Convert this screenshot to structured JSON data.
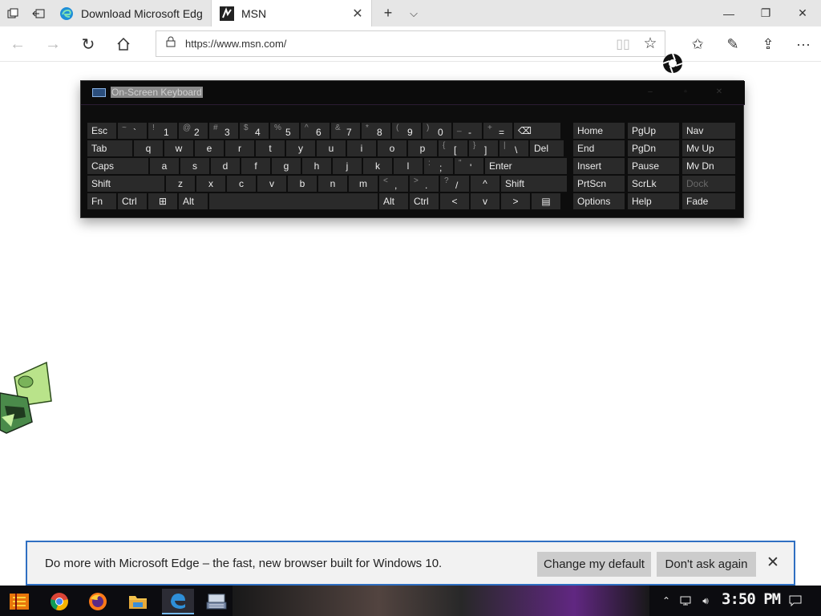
{
  "tabs": [
    {
      "title": "Download Microsoft Edge",
      "active": false
    },
    {
      "title": "MSN",
      "active": true
    }
  ],
  "address": {
    "url": "https://www.msn.com/"
  },
  "osk": {
    "title": "On-Screen Keyboard",
    "rows": [
      [
        {
          "label": "Esc",
          "w": 36
        },
        {
          "shift": "~",
          "main": "`",
          "w": 36
        },
        {
          "shift": "!",
          "main": "1",
          "w": 36
        },
        {
          "shift": "@",
          "main": "2",
          "w": 36
        },
        {
          "shift": "#",
          "main": "3",
          "w": 36
        },
        {
          "shift": "$",
          "main": "4",
          "w": 36
        },
        {
          "shift": "%",
          "main": "5",
          "w": 36
        },
        {
          "shift": "^",
          "main": "6",
          "w": 36
        },
        {
          "shift": "&",
          "main": "7",
          "w": 36
        },
        {
          "shift": "*",
          "main": "8",
          "w": 36
        },
        {
          "shift": "(",
          "main": "9",
          "w": 36
        },
        {
          "shift": ")",
          "main": "0",
          "w": 36
        },
        {
          "shift": "_",
          "main": "-",
          "w": 36
        },
        {
          "shift": "+",
          "main": "=",
          "w": 36
        },
        {
          "label": "⌫",
          "w": 58
        }
      ],
      [
        {
          "label": "Tab",
          "w": 56
        },
        {
          "label": "q",
          "w": 36,
          "c": true
        },
        {
          "label": "w",
          "w": 36,
          "c": true
        },
        {
          "label": "e",
          "w": 36,
          "c": true
        },
        {
          "label": "r",
          "w": 36,
          "c": true
        },
        {
          "label": "t",
          "w": 36,
          "c": true
        },
        {
          "label": "y",
          "w": 36,
          "c": true
        },
        {
          "label": "u",
          "w": 36,
          "c": true
        },
        {
          "label": "i",
          "w": 36,
          "c": true
        },
        {
          "label": "o",
          "w": 36,
          "c": true
        },
        {
          "label": "p",
          "w": 36,
          "c": true
        },
        {
          "shift": "{",
          "main": "[",
          "w": 36
        },
        {
          "shift": "}",
          "main": "]",
          "w": 36
        },
        {
          "shift": "|",
          "main": "\\",
          "w": 36
        },
        {
          "label": "Del",
          "w": 42
        }
      ],
      [
        {
          "label": "Caps",
          "w": 76
        },
        {
          "label": "a",
          "w": 36,
          "c": true
        },
        {
          "label": "s",
          "w": 36,
          "c": true
        },
        {
          "label": "d",
          "w": 36,
          "c": true
        },
        {
          "label": "f",
          "w": 36,
          "c": true
        },
        {
          "label": "g",
          "w": 36,
          "c": true
        },
        {
          "label": "h",
          "w": 36,
          "c": true
        },
        {
          "label": "j",
          "w": 36,
          "c": true
        },
        {
          "label": "k",
          "w": 36,
          "c": true
        },
        {
          "label": "l",
          "w": 36,
          "c": true
        },
        {
          "shift": ":",
          "main": ";",
          "w": 36
        },
        {
          "shift": "\"",
          "main": "'",
          "w": 36
        },
        {
          "label": "Enter",
          "w": 102
        }
      ],
      [
        {
          "label": "Shift",
          "w": 96
        },
        {
          "label": "z",
          "w": 36,
          "c": true
        },
        {
          "label": "x",
          "w": 36,
          "c": true
        },
        {
          "label": "c",
          "w": 36,
          "c": true
        },
        {
          "label": "v",
          "w": 36,
          "c": true
        },
        {
          "label": "b",
          "w": 36,
          "c": true
        },
        {
          "label": "n",
          "w": 36,
          "c": true
        },
        {
          "label": "m",
          "w": 36,
          "c": true
        },
        {
          "shift": "<",
          "main": ",",
          "w": 36
        },
        {
          "shift": ">",
          "main": ".",
          "w": 36
        },
        {
          "shift": "?",
          "main": "/",
          "w": 36
        },
        {
          "label": "^",
          "w": 36,
          "c": true
        },
        {
          "label": "Shift",
          "w": 82
        }
      ],
      [
        {
          "label": "Fn",
          "w": 36
        },
        {
          "label": "Ctrl",
          "w": 36
        },
        {
          "label": "⊞",
          "w": 36,
          "c": true
        },
        {
          "label": "Alt",
          "w": 36
        },
        {
          "label": "",
          "w": 210
        },
        {
          "label": "Alt",
          "w": 36
        },
        {
          "label": "Ctrl",
          "w": 36
        },
        {
          "label": "<",
          "w": 36,
          "c": true
        },
        {
          "label": "v",
          "w": 36,
          "c": true
        },
        {
          "label": ">",
          "w": 36,
          "c": true
        },
        {
          "label": "▤",
          "w": 36,
          "c": true
        }
      ]
    ],
    "nav_rows": [
      [
        "Home",
        "PgUp",
        "Nav"
      ],
      [
        "End",
        "PgDn",
        "Mv Up"
      ],
      [
        "Insert",
        "Pause",
        "Mv Dn"
      ],
      [
        "PrtScn",
        "ScrLk",
        "Dock"
      ],
      [
        "Options",
        "Help",
        "Fade"
      ]
    ]
  },
  "banner": {
    "message": "Do more with Microsoft Edge – the fast, new browser built for Windows 10.",
    "change_default": "Change my default",
    "dont_ask": "Don't ask again"
  },
  "taskbar": {
    "clock": "3:50 PM"
  }
}
